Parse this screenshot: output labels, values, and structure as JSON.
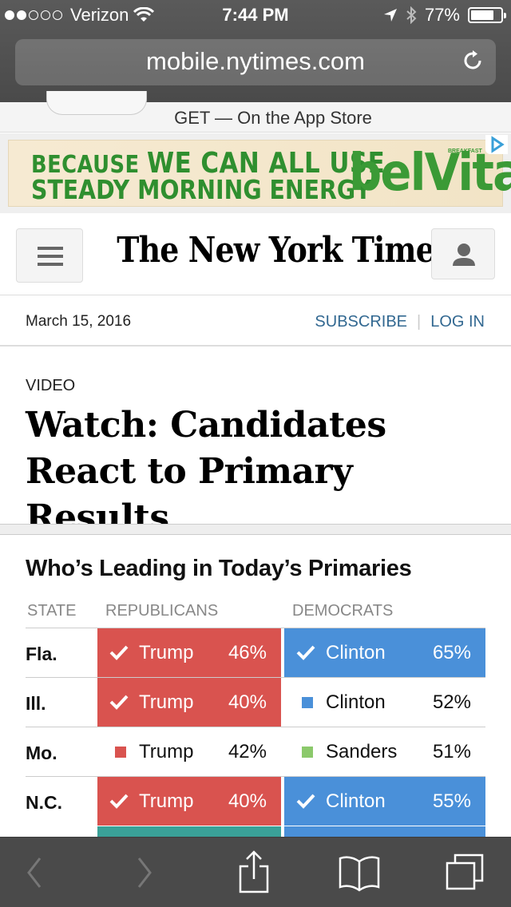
{
  "status": {
    "carrier": "Verizon",
    "time": "7:44 PM",
    "battery": "77%",
    "battery_level": 0.77
  },
  "browser": {
    "url": "mobile.nytimes.com",
    "reload_icon": "reload-icon"
  },
  "app_banner": {
    "text": "GET — On the App Store"
  },
  "ad": {
    "line1_a": "BECAUSE",
    "line1_b": "WE CAN ALL USE",
    "line2": "STEADY MORNING ENERGY",
    "brand": "belVita",
    "tag": "BREAKFAST"
  },
  "header": {
    "logo": "The New York Times",
    "date": "March 15, 2016",
    "subscribe": "SUBSCRIBE",
    "login": "LOG IN"
  },
  "article": {
    "kicker": "VIDEO",
    "headline": "Watch: Candidates React to Primary Results"
  },
  "results": {
    "title": "Who’s Leading in Today’s Primaries",
    "headers": {
      "state": "STATE",
      "rep": "REPUBLICANS",
      "dem": "DEMOCRATS"
    },
    "colors": {
      "rep": "#d9534f",
      "dem": "#4a90d9",
      "sanders": "#8bc96b",
      "kasich_partial": "#3aa198"
    },
    "rows": [
      {
        "state": "Fla.",
        "rep": {
          "name": "Trump",
          "pct": "46%",
          "winner": true
        },
        "dem": {
          "name": "Clinton",
          "pct": "65%",
          "winner": true
        }
      },
      {
        "state": "Ill.",
        "rep": {
          "name": "Trump",
          "pct": "40%",
          "winner": true
        },
        "dem": {
          "name": "Clinton",
          "pct": "52%",
          "winner": false
        }
      },
      {
        "state": "Mo.",
        "rep": {
          "name": "Trump",
          "pct": "42%",
          "winner": false
        },
        "dem": {
          "name": "Sanders",
          "pct": "51%",
          "winner": false
        }
      },
      {
        "state": "N.C.",
        "rep": {
          "name": "Trump",
          "pct": "40%",
          "winner": true
        },
        "dem": {
          "name": "Clinton",
          "pct": "55%",
          "winner": true
        }
      }
    ]
  }
}
